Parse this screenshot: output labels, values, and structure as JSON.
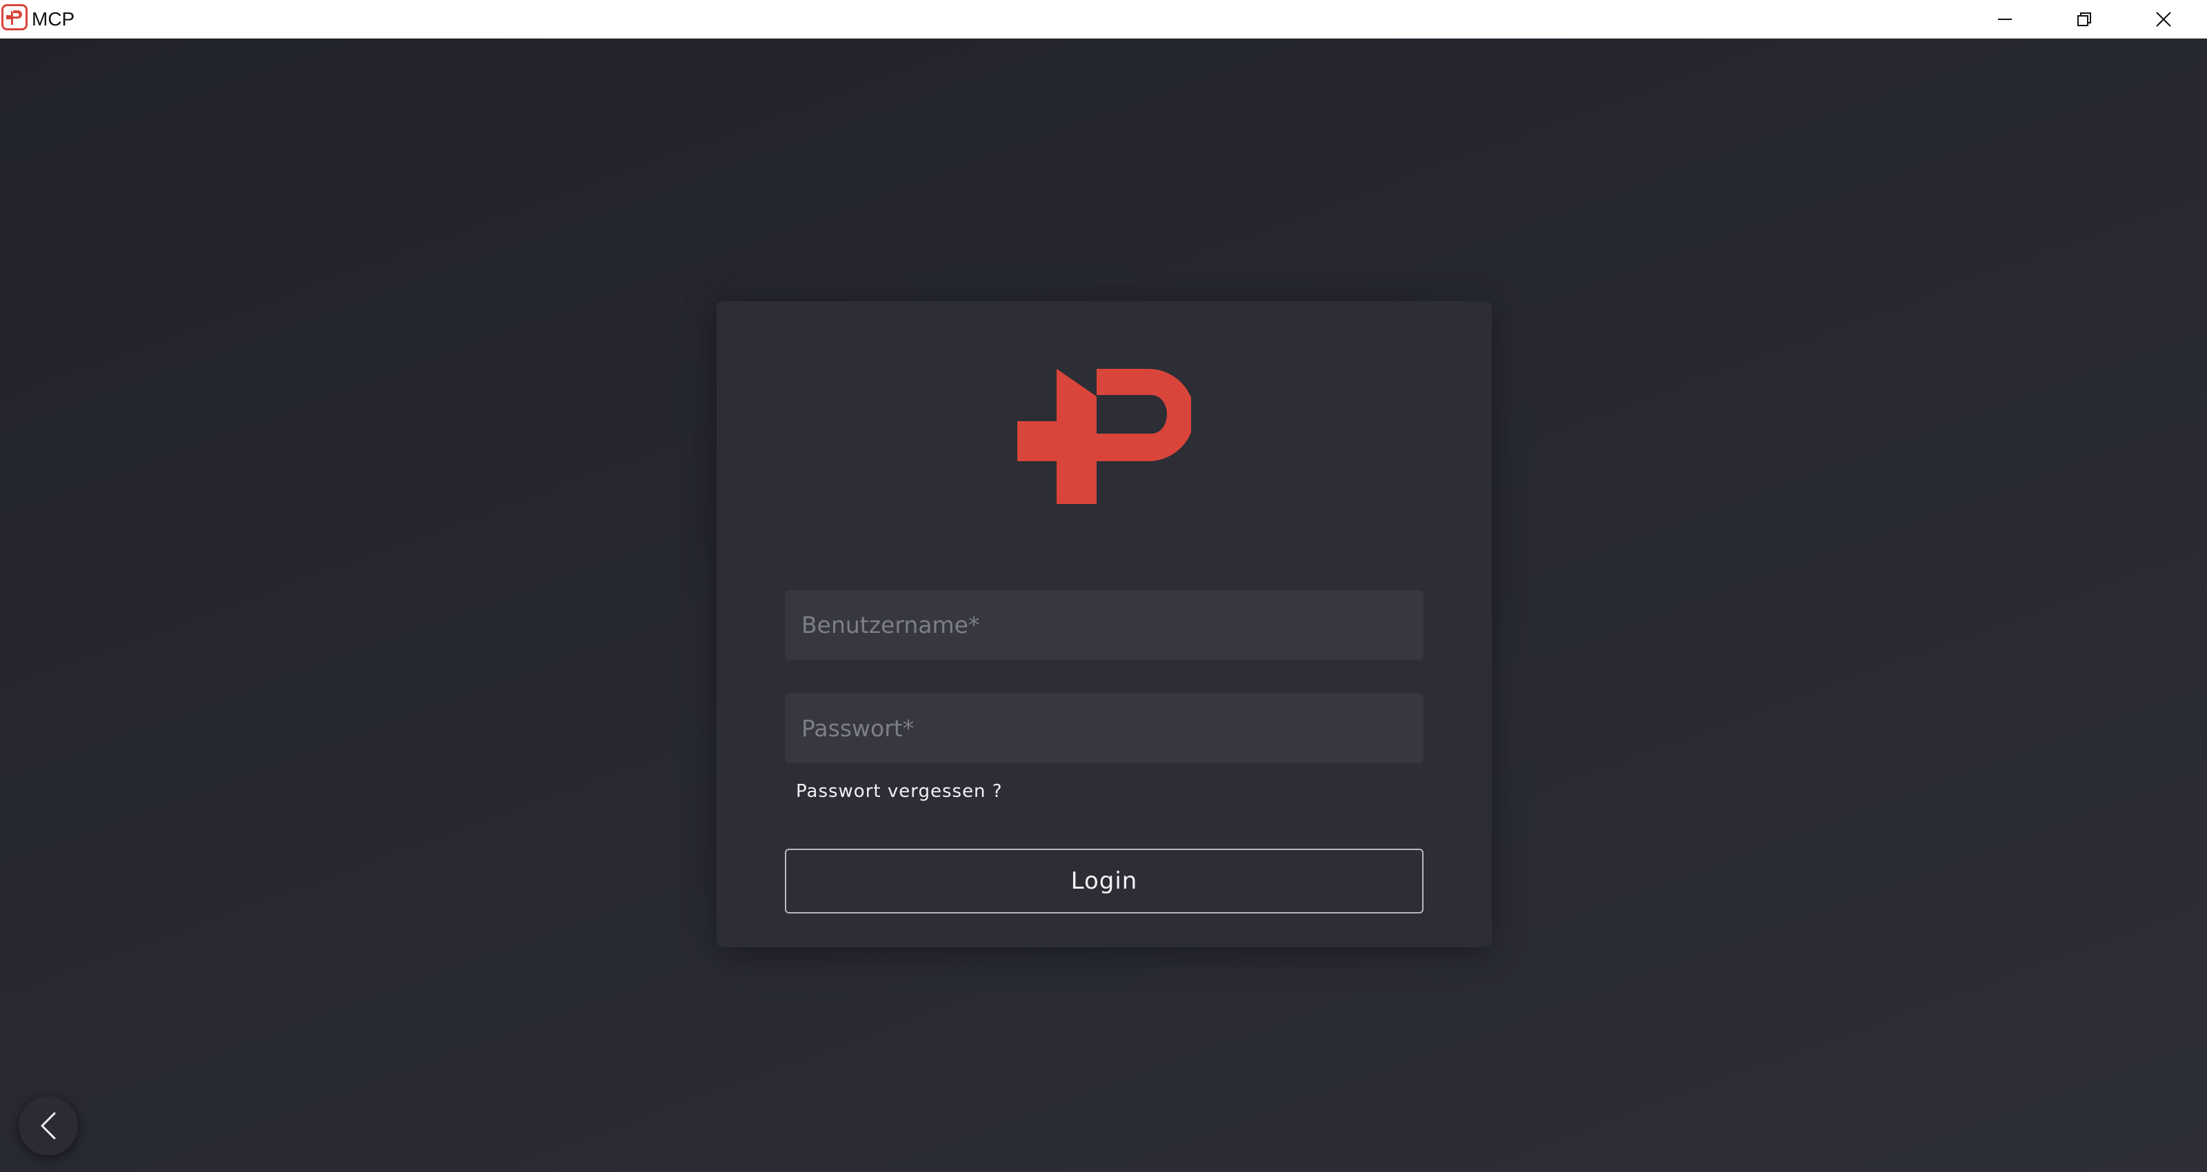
{
  "window": {
    "title": "MCP",
    "app_icon": "mcp-logo-icon",
    "controls": {
      "minimize_icon": "minimize-icon",
      "maximize_icon": "restore-icon",
      "close_icon": "close-icon"
    }
  },
  "login": {
    "logo_icon": "mcp-logo",
    "username_placeholder": "Benutzername*",
    "username_value": "",
    "password_placeholder": "Passwort*",
    "password_value": "",
    "forgot_password_label": "Passwort vergessen ?",
    "login_button_label": "Login"
  },
  "navigation": {
    "back_icon": "chevron-left-icon"
  },
  "colors": {
    "brand": "#d9453a",
    "background": "#26272e",
    "card": "#2c2d35",
    "input": "#363740",
    "text": "#f2f2f5",
    "placeholder": "#7d7e88"
  }
}
